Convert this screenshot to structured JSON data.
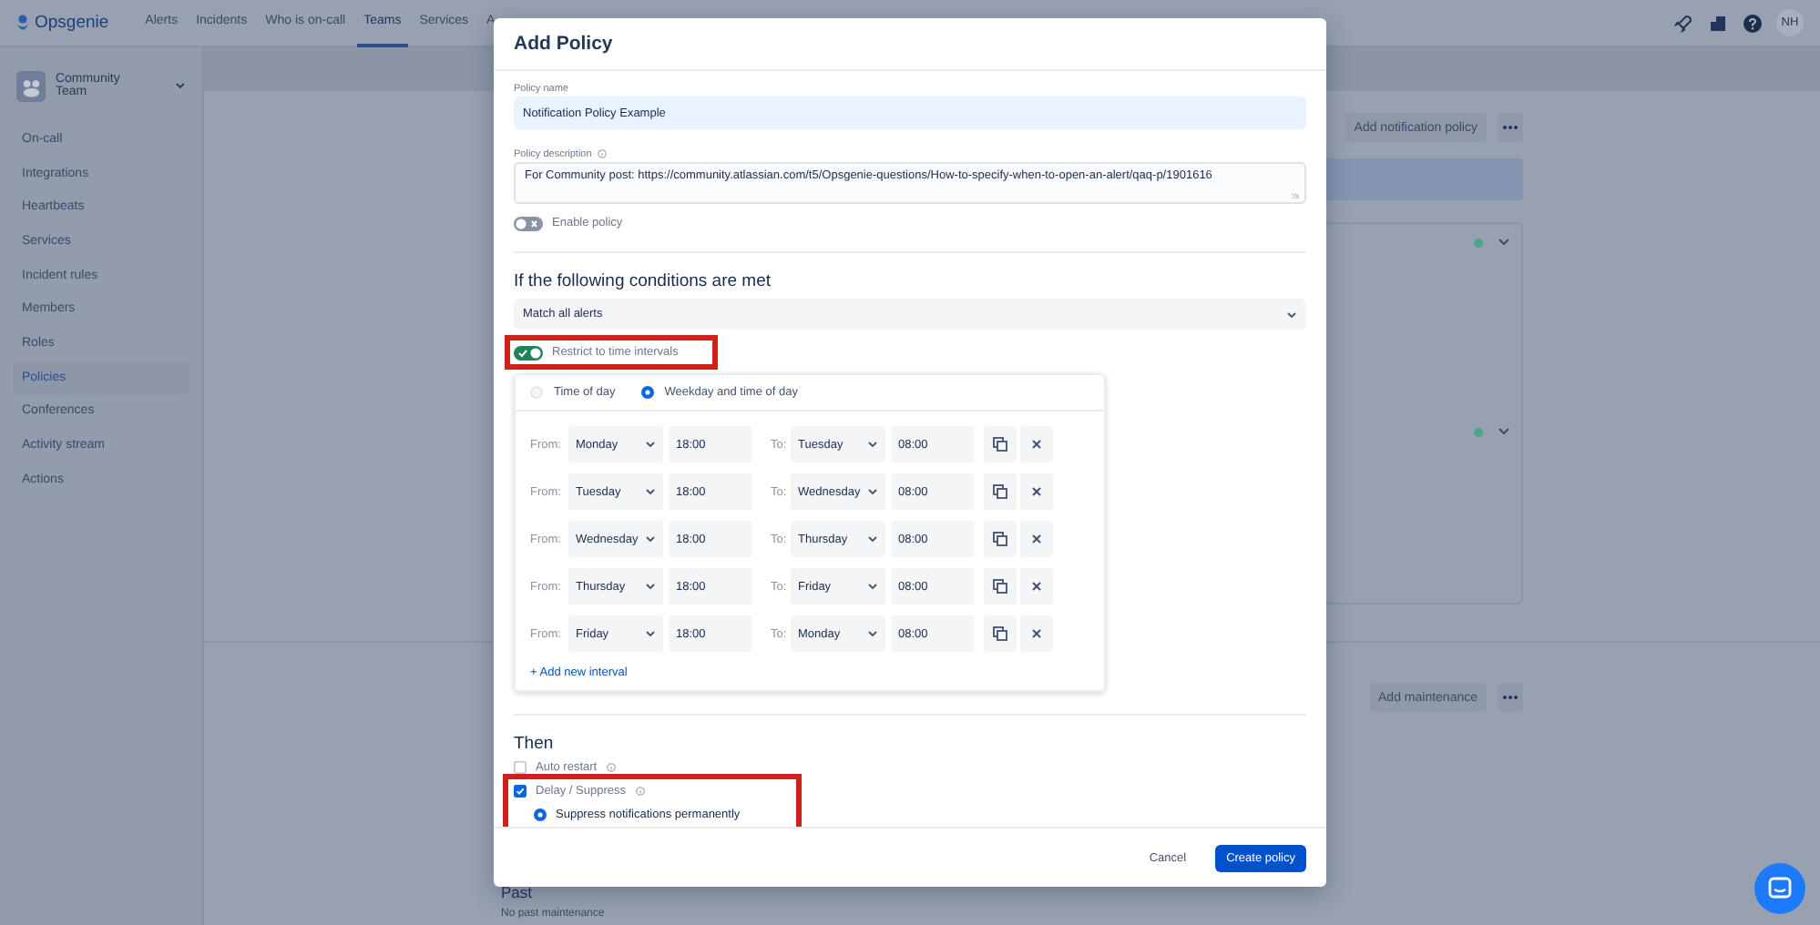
{
  "topnav": {
    "brand": "Opsgenie",
    "avatar": "NH",
    "items": [
      {
        "label": "Alerts",
        "selected": false
      },
      {
        "label": "Incidents",
        "selected": false
      },
      {
        "label": "Who is on-call",
        "selected": false
      },
      {
        "label": "Teams",
        "selected": true
      },
      {
        "label": "Services",
        "selected": false
      },
      {
        "label": "A",
        "selected": false
      }
    ]
  },
  "sidebar": {
    "team": "Community Team",
    "items": [
      {
        "label": "On-call",
        "selected": false
      },
      {
        "label": "Integrations",
        "selected": false
      },
      {
        "label": "Heartbeats",
        "selected": false
      },
      {
        "label": "Services",
        "selected": false
      },
      {
        "label": "Incident rules",
        "selected": false
      },
      {
        "label": "Members",
        "selected": false
      },
      {
        "label": "Roles",
        "selected": false
      },
      {
        "label": "Policies",
        "selected": true
      },
      {
        "label": "Conferences",
        "selected": false
      },
      {
        "label": "Activity stream",
        "selected": false
      },
      {
        "label": "Actions",
        "selected": false
      }
    ]
  },
  "background": {
    "add_policy_button": "Add notification policy",
    "add_maintenance_button": "Add maintenance",
    "past_heading": "Past",
    "past_text": "No past maintenance"
  },
  "modal": {
    "title": "Add Policy",
    "policy_name": {
      "label": "Policy name",
      "value": "Notification Policy Example"
    },
    "policy_description": {
      "label": "Policy description",
      "value": "For Community post: https://community.atlassian.com/t5/Opsgenie-questions/How-to-specify-when-to-open-an-alert/qaq-p/1901616",
      "counter": "78"
    },
    "enable_policy": {
      "label": "Enable policy",
      "on": false
    },
    "conditions": {
      "heading": "If the following conditions are met",
      "match": "Match all alerts"
    },
    "restrict": {
      "label": "Restrict to time intervals",
      "on": true,
      "highlighted": true
    },
    "interval_modes": [
      {
        "label": "Time of day",
        "selected": false
      },
      {
        "label": "Weekday and time of day",
        "selected": true
      }
    ],
    "intervals": [
      {
        "from_label": "From:",
        "from_day": "Monday",
        "from_time": "18:00",
        "to_label": "To:",
        "to_day": "Tuesday",
        "to_time": "08:00"
      },
      {
        "from_label": "From:",
        "from_day": "Tuesday",
        "from_time": "18:00",
        "to_label": "To:",
        "to_day": "Wednesday",
        "to_time": "08:00"
      },
      {
        "from_label": "From:",
        "from_day": "Wednesday",
        "from_time": "18:00",
        "to_label": "To:",
        "to_day": "Thursday",
        "to_time": "08:00"
      },
      {
        "from_label": "From:",
        "from_day": "Thursday",
        "from_time": "18:00",
        "to_label": "To:",
        "to_day": "Friday",
        "to_time": "08:00"
      },
      {
        "from_label": "From:",
        "from_day": "Friday",
        "from_time": "18:00",
        "to_label": "To:",
        "to_day": "Monday",
        "to_time": "08:00"
      }
    ],
    "add_interval": "+ Add new interval",
    "then": {
      "heading": "Then",
      "auto_restart": {
        "label": "Auto restart",
        "checked": false
      },
      "delay_suppress": {
        "label": "Delay / Suppress",
        "checked": true,
        "highlighted": true,
        "options": [
          {
            "label": "Suppress notifications permanently",
            "selected": true
          }
        ]
      }
    },
    "cancel": "Cancel",
    "create": "Create policy"
  }
}
